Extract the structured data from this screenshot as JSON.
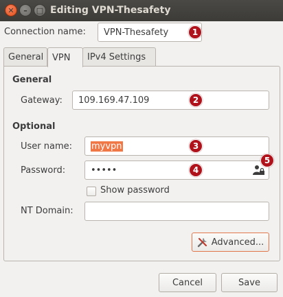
{
  "window": {
    "title": "Editing VPN-Thesafety"
  },
  "connection": {
    "label": "Connection name:",
    "value": "VPN-Thesafety"
  },
  "tabs": [
    {
      "label": "General"
    },
    {
      "label": "VPN"
    },
    {
      "label": "IPv4 Settings"
    }
  ],
  "general": {
    "heading": "General",
    "gateway_label": "Gateway:",
    "gateway_value": "109.169.47.109"
  },
  "optional": {
    "heading": "Optional",
    "username_label": "User name:",
    "username_value": "myvpn",
    "password_label": "Password:",
    "password_value": "•••••",
    "show_password_label": "Show password",
    "ntdomain_label": "NT Domain:",
    "ntdomain_value": ""
  },
  "buttons": {
    "advanced": "Advanced...",
    "cancel": "Cancel",
    "save": "Save"
  },
  "badges": [
    "1",
    "2",
    "3",
    "4",
    "5"
  ],
  "colors": {
    "badge": "#b0121c",
    "selection": "#f07746",
    "titlebar": "#3c3b37"
  }
}
